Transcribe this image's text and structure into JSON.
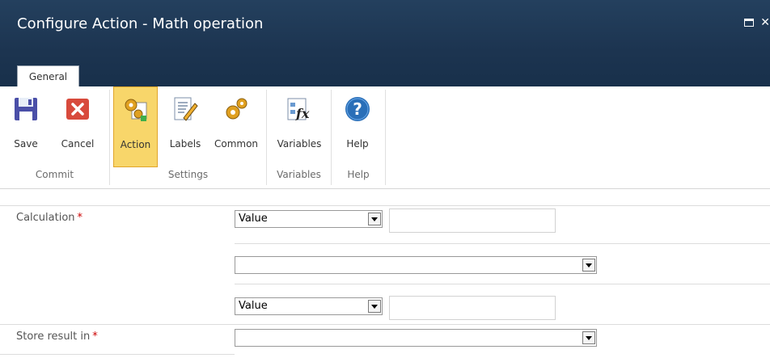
{
  "window": {
    "title": "Configure Action - Math operation",
    "maximize_icon": "maximize-icon",
    "close_icon": "close-icon"
  },
  "tabs": [
    {
      "label": "General",
      "active": true
    }
  ],
  "ribbon": {
    "groups": [
      {
        "label": "Commit",
        "buttons": [
          {
            "label": "Save",
            "icon": "save-disk-icon"
          },
          {
            "label": "Cancel",
            "icon": "cancel-x-icon"
          }
        ]
      },
      {
        "label": "Settings",
        "buttons": [
          {
            "label": "Action",
            "icon": "action-gears-icon",
            "active": true
          },
          {
            "label": "Labels",
            "icon": "labels-pencil-icon"
          },
          {
            "label": "Common",
            "icon": "common-gears-icon"
          }
        ]
      },
      {
        "label": "Variables",
        "buttons": [
          {
            "label": "Variables",
            "icon": "variables-fx-icon"
          }
        ]
      },
      {
        "label": "Help",
        "buttons": [
          {
            "label": "Help",
            "icon": "help-question-icon"
          }
        ]
      }
    ]
  },
  "form": {
    "calculation": {
      "label": "Calculation",
      "required_mark": "*",
      "operand1": {
        "type": "Value",
        "value": ""
      },
      "operator": {
        "value": ""
      },
      "operand2": {
        "type": "Value",
        "value": ""
      }
    },
    "store_result": {
      "label": "Store result in",
      "required_mark": "*",
      "value": ""
    }
  },
  "colors": {
    "titlebar": "#1c3450",
    "accent": "#f8d66a",
    "required": "#cc0000"
  }
}
